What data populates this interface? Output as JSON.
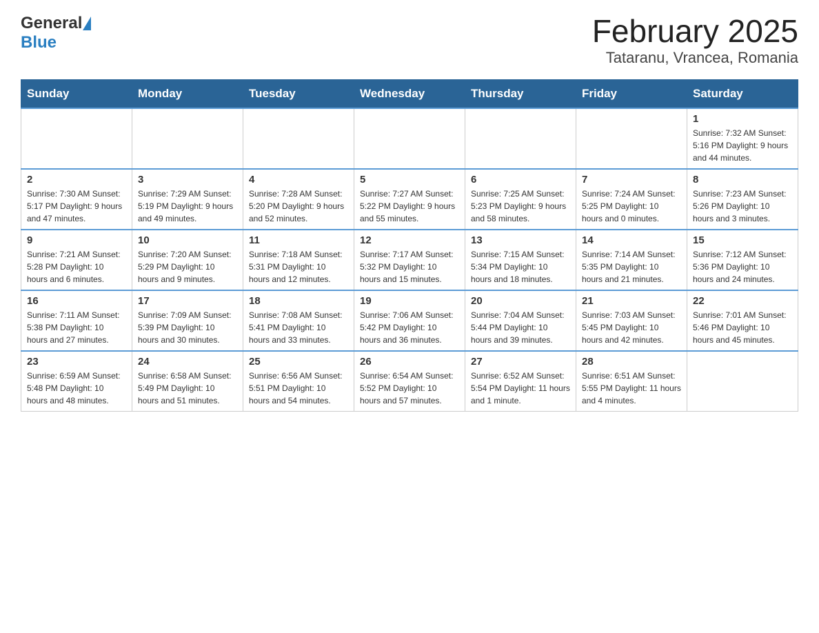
{
  "header": {
    "title": "February 2025",
    "subtitle": "Tataranu, Vrancea, Romania",
    "logo_general": "General",
    "logo_blue": "Blue"
  },
  "days_of_week": [
    "Sunday",
    "Monday",
    "Tuesday",
    "Wednesday",
    "Thursday",
    "Friday",
    "Saturday"
  ],
  "weeks": [
    [
      {
        "day": "",
        "info": ""
      },
      {
        "day": "",
        "info": ""
      },
      {
        "day": "",
        "info": ""
      },
      {
        "day": "",
        "info": ""
      },
      {
        "day": "",
        "info": ""
      },
      {
        "day": "",
        "info": ""
      },
      {
        "day": "1",
        "info": "Sunrise: 7:32 AM\nSunset: 5:16 PM\nDaylight: 9 hours\nand 44 minutes."
      }
    ],
    [
      {
        "day": "2",
        "info": "Sunrise: 7:30 AM\nSunset: 5:17 PM\nDaylight: 9 hours\nand 47 minutes."
      },
      {
        "day": "3",
        "info": "Sunrise: 7:29 AM\nSunset: 5:19 PM\nDaylight: 9 hours\nand 49 minutes."
      },
      {
        "day": "4",
        "info": "Sunrise: 7:28 AM\nSunset: 5:20 PM\nDaylight: 9 hours\nand 52 minutes."
      },
      {
        "day": "5",
        "info": "Sunrise: 7:27 AM\nSunset: 5:22 PM\nDaylight: 9 hours\nand 55 minutes."
      },
      {
        "day": "6",
        "info": "Sunrise: 7:25 AM\nSunset: 5:23 PM\nDaylight: 9 hours\nand 58 minutes."
      },
      {
        "day": "7",
        "info": "Sunrise: 7:24 AM\nSunset: 5:25 PM\nDaylight: 10 hours\nand 0 minutes."
      },
      {
        "day": "8",
        "info": "Sunrise: 7:23 AM\nSunset: 5:26 PM\nDaylight: 10 hours\nand 3 minutes."
      }
    ],
    [
      {
        "day": "9",
        "info": "Sunrise: 7:21 AM\nSunset: 5:28 PM\nDaylight: 10 hours\nand 6 minutes."
      },
      {
        "day": "10",
        "info": "Sunrise: 7:20 AM\nSunset: 5:29 PM\nDaylight: 10 hours\nand 9 minutes."
      },
      {
        "day": "11",
        "info": "Sunrise: 7:18 AM\nSunset: 5:31 PM\nDaylight: 10 hours\nand 12 minutes."
      },
      {
        "day": "12",
        "info": "Sunrise: 7:17 AM\nSunset: 5:32 PM\nDaylight: 10 hours\nand 15 minutes."
      },
      {
        "day": "13",
        "info": "Sunrise: 7:15 AM\nSunset: 5:34 PM\nDaylight: 10 hours\nand 18 minutes."
      },
      {
        "day": "14",
        "info": "Sunrise: 7:14 AM\nSunset: 5:35 PM\nDaylight: 10 hours\nand 21 minutes."
      },
      {
        "day": "15",
        "info": "Sunrise: 7:12 AM\nSunset: 5:36 PM\nDaylight: 10 hours\nand 24 minutes."
      }
    ],
    [
      {
        "day": "16",
        "info": "Sunrise: 7:11 AM\nSunset: 5:38 PM\nDaylight: 10 hours\nand 27 minutes."
      },
      {
        "day": "17",
        "info": "Sunrise: 7:09 AM\nSunset: 5:39 PM\nDaylight: 10 hours\nand 30 minutes."
      },
      {
        "day": "18",
        "info": "Sunrise: 7:08 AM\nSunset: 5:41 PM\nDaylight: 10 hours\nand 33 minutes."
      },
      {
        "day": "19",
        "info": "Sunrise: 7:06 AM\nSunset: 5:42 PM\nDaylight: 10 hours\nand 36 minutes."
      },
      {
        "day": "20",
        "info": "Sunrise: 7:04 AM\nSunset: 5:44 PM\nDaylight: 10 hours\nand 39 minutes."
      },
      {
        "day": "21",
        "info": "Sunrise: 7:03 AM\nSunset: 5:45 PM\nDaylight: 10 hours\nand 42 minutes."
      },
      {
        "day": "22",
        "info": "Sunrise: 7:01 AM\nSunset: 5:46 PM\nDaylight: 10 hours\nand 45 minutes."
      }
    ],
    [
      {
        "day": "23",
        "info": "Sunrise: 6:59 AM\nSunset: 5:48 PM\nDaylight: 10 hours\nand 48 minutes."
      },
      {
        "day": "24",
        "info": "Sunrise: 6:58 AM\nSunset: 5:49 PM\nDaylight: 10 hours\nand 51 minutes."
      },
      {
        "day": "25",
        "info": "Sunrise: 6:56 AM\nSunset: 5:51 PM\nDaylight: 10 hours\nand 54 minutes."
      },
      {
        "day": "26",
        "info": "Sunrise: 6:54 AM\nSunset: 5:52 PM\nDaylight: 10 hours\nand 57 minutes."
      },
      {
        "day": "27",
        "info": "Sunrise: 6:52 AM\nSunset: 5:54 PM\nDaylight: 11 hours\nand 1 minute."
      },
      {
        "day": "28",
        "info": "Sunrise: 6:51 AM\nSunset: 5:55 PM\nDaylight: 11 hours\nand 4 minutes."
      },
      {
        "day": "",
        "info": ""
      }
    ]
  ]
}
